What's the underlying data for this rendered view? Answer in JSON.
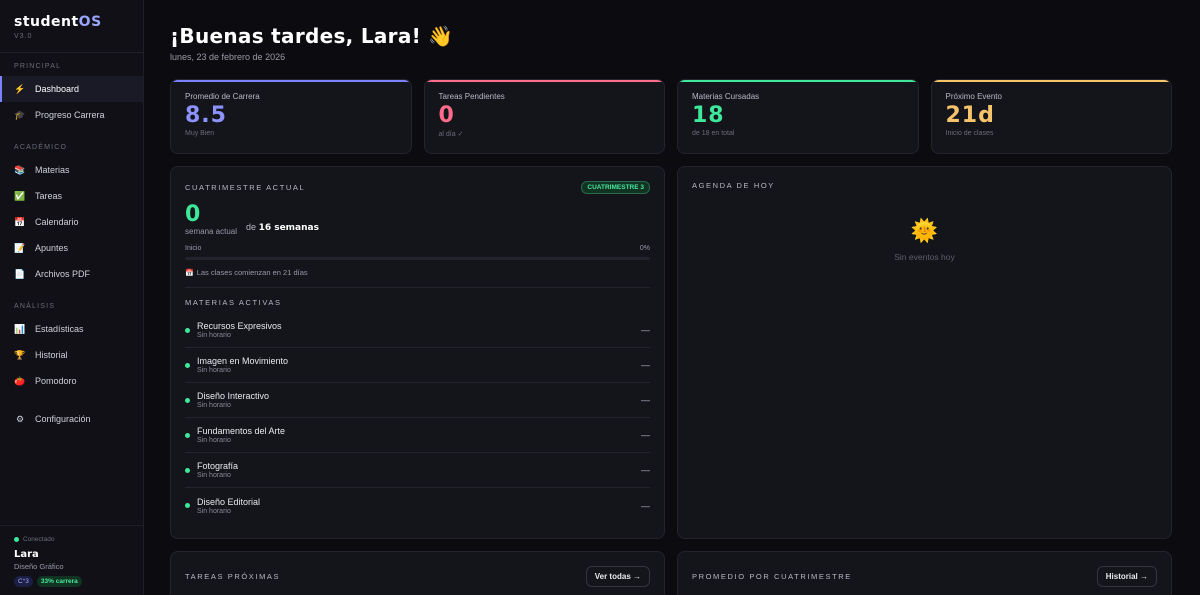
{
  "brand": {
    "name_main": "student",
    "name_accent": "OS",
    "version": "V3.0"
  },
  "sidebar": {
    "sections": [
      {
        "label": "PRINCIPAL",
        "items": [
          {
            "icon": "⚡",
            "label": "Dashboard",
            "active": true
          },
          {
            "icon": "🎓",
            "label": "Progreso Carrera"
          }
        ]
      },
      {
        "label": "ACADÉMICO",
        "items": [
          {
            "icon": "📚",
            "label": "Materias"
          },
          {
            "icon": "✅",
            "label": "Tareas"
          },
          {
            "icon": "📅",
            "label": "Calendario"
          },
          {
            "icon": "📝",
            "label": "Apuntes"
          },
          {
            "icon": "📄",
            "label": "Archivos PDF"
          }
        ]
      },
      {
        "label": "ANÁLISIS",
        "items": [
          {
            "icon": "📊",
            "label": "Estadísticas"
          },
          {
            "icon": "🏆",
            "label": "Historial"
          },
          {
            "icon": "🍅",
            "label": "Pomodoro"
          }
        ]
      }
    ],
    "settings": {
      "icon": "⚙",
      "label": "Configuración"
    }
  },
  "user": {
    "status": "Conectado",
    "name": "Lara",
    "career": "Diseño Gráfico",
    "cuat_badge": "C°3",
    "career_badge": "33% carrera"
  },
  "header": {
    "greeting": "¡Buenas tardes, Lara! 👋",
    "date": "lunes, 23 de febrero de 2026"
  },
  "stats": [
    {
      "label": "Promedio de Carrera",
      "value": "8.5",
      "sub": "Muy Bien"
    },
    {
      "label": "Tareas Pendientes",
      "value": "0",
      "sub": "al día ✓"
    },
    {
      "label": "Materias Cursadas",
      "value": "18",
      "sub": "de 18 en total"
    },
    {
      "label": "Próximo Evento",
      "value": "21d",
      "sub": "Inicio de clases"
    }
  ],
  "cuatrimestre": {
    "title": "CUATRIMESTRE ACTUAL",
    "pill": "CUATRIMESTRE 3",
    "week": "0",
    "week_label": "semana actual",
    "week_of": "de",
    "week_total": "16 semanas",
    "progress_start": "Inicio",
    "progress_pct_label": "0%",
    "progress": 0,
    "notice_icon": "📅",
    "notice": "Las clases comienzan en 21 días",
    "subjects_title": "MATERIAS ACTIVAS",
    "subjects": [
      {
        "name": "Recursos Expresivos",
        "sched": "Sin horario",
        "value": "—"
      },
      {
        "name": "Imagen en Movimiento",
        "sched": "Sin horario",
        "value": "—"
      },
      {
        "name": "Diseño Interactivo",
        "sched": "Sin horario",
        "value": "—"
      },
      {
        "name": "Fundamentos del Arte",
        "sched": "Sin horario",
        "value": "—"
      },
      {
        "name": "Fotografía",
        "sched": "Sin horario",
        "value": "—"
      },
      {
        "name": "Diseño Editorial",
        "sched": "Sin horario",
        "value": "—"
      }
    ]
  },
  "agenda": {
    "title": "AGENDA DE HOY",
    "empty_icon": "🌞",
    "empty": "Sin eventos hoy"
  },
  "tareas": {
    "title": "TAREAS PRÓXIMAS",
    "button": "Ver todas →"
  },
  "promedio": {
    "title": "PROMEDIO POR CUATRIMESTRE",
    "button": "Historial →"
  }
}
